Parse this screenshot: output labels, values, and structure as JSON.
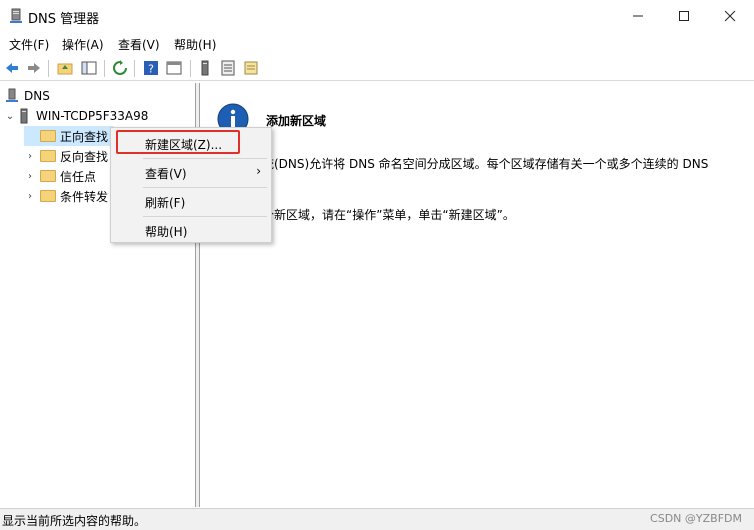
{
  "window": {
    "title": "DNS 管理器"
  },
  "menu": [
    "文件(F)",
    "操作(A)",
    "查看(V)",
    "帮助(H)"
  ],
  "tree": {
    "root": "DNS",
    "server": "WIN-TCDP5F33A98",
    "zones": [
      "正向查找",
      "反向查找",
      "信任点",
      "条件转发"
    ]
  },
  "context_menu": {
    "new_zone": "新建区域(Z)...",
    "view": "查看(V)",
    "refresh": "刷新(F)",
    "help": "帮助(H)"
  },
  "info": {
    "title": "添加新区域",
    "line1": "统(DNS)允许将 DNS 命名空间分成区域。每个区域存储有关一个或多个连续的 DNS",
    "line2": "个新区域，请在“操作”菜单，单击“新建区域”。"
  },
  "status": {
    "text": "显示当前所选内容的帮助。",
    "watermark": "CSDN @YZBFDM"
  },
  "colors": {
    "highlight_border": "#e0302a",
    "selection": "#cce8ff",
    "info_icon": "#1e5fb3"
  }
}
